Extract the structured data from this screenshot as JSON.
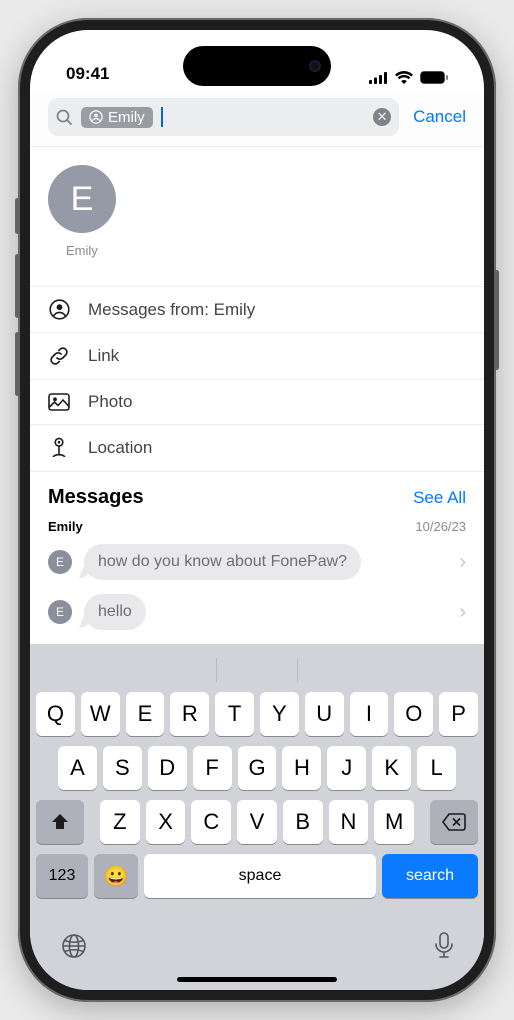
{
  "status": {
    "time": "09:41"
  },
  "search": {
    "chip_text": "Emily",
    "cancel": "Cancel"
  },
  "contact": {
    "initial": "E",
    "name": "Emily"
  },
  "filters": {
    "messages_from": "Messages from: Emily",
    "link": "Link",
    "photo": "Photo",
    "location": "Location"
  },
  "section": {
    "title": "Messages",
    "see_all": "See All"
  },
  "thread": {
    "name": "Emily",
    "date": "10/26/23",
    "messages": [
      {
        "initial": "E",
        "text": "how do you know about FonePaw?"
      },
      {
        "initial": "E",
        "text": "hello"
      }
    ]
  },
  "keyboard": {
    "row1": [
      "Q",
      "W",
      "E",
      "R",
      "T",
      "Y",
      "U",
      "I",
      "O",
      "P"
    ],
    "row2": [
      "A",
      "S",
      "D",
      "F",
      "G",
      "H",
      "J",
      "K",
      "L"
    ],
    "row3": [
      "Z",
      "X",
      "C",
      "V",
      "B",
      "N",
      "M"
    ],
    "switch": "123",
    "space": "space",
    "search": "search"
  }
}
